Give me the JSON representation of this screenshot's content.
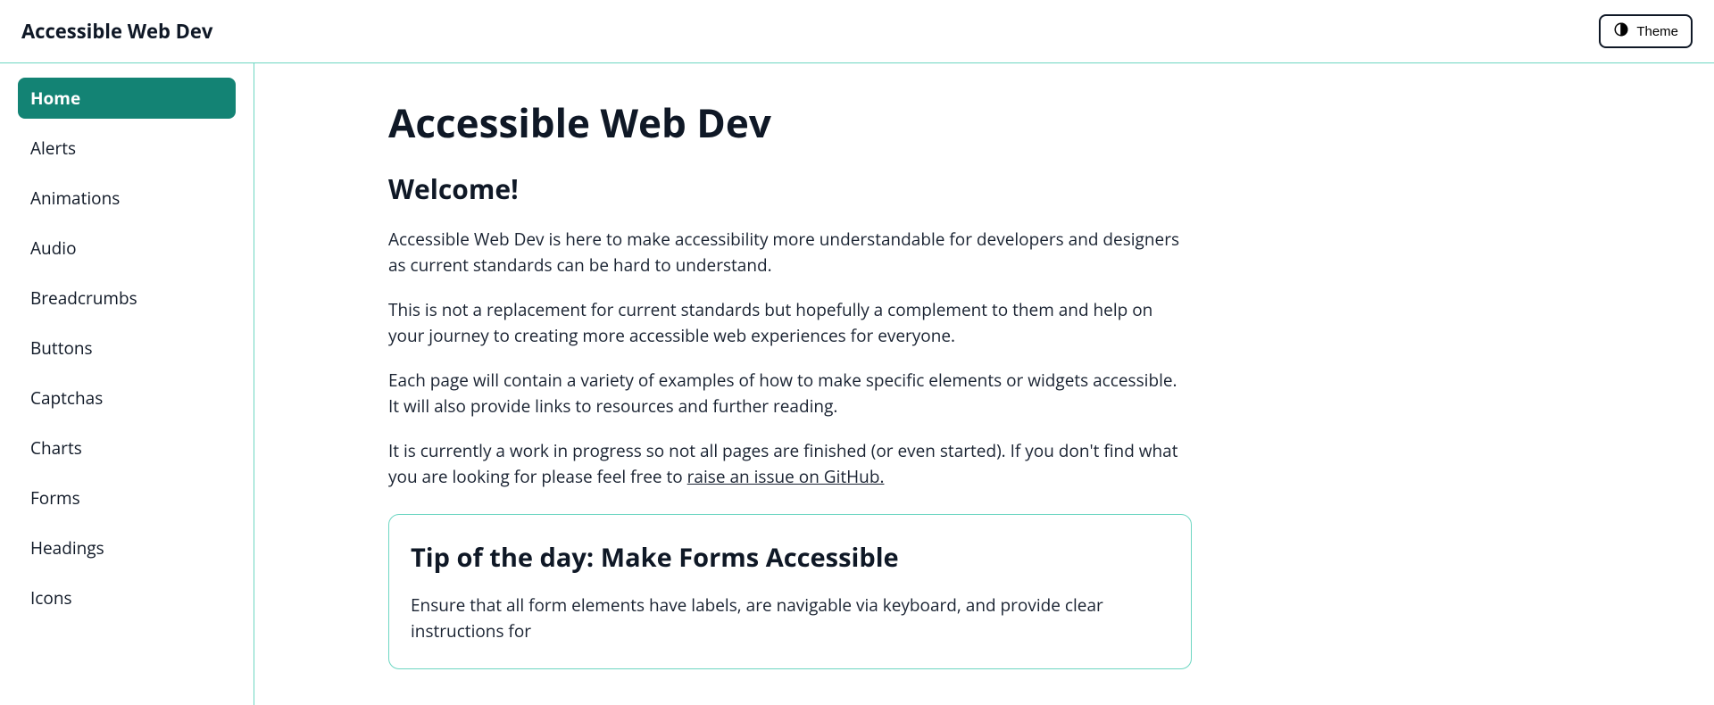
{
  "header": {
    "logo": "Accessible Web Dev",
    "theme_label": "Theme"
  },
  "sidebar": {
    "items": [
      {
        "label": "Home",
        "active": true
      },
      {
        "label": "Alerts",
        "active": false
      },
      {
        "label": "Animations",
        "active": false
      },
      {
        "label": "Audio",
        "active": false
      },
      {
        "label": "Breadcrumbs",
        "active": false
      },
      {
        "label": "Buttons",
        "active": false
      },
      {
        "label": "Captchas",
        "active": false
      },
      {
        "label": "Charts",
        "active": false
      },
      {
        "label": "Forms",
        "active": false
      },
      {
        "label": "Headings",
        "active": false
      },
      {
        "label": "Icons",
        "active": false
      }
    ]
  },
  "main": {
    "title": "Accessible Web Dev",
    "welcome": "Welcome!",
    "p1": "Accessible Web Dev is here to make accessibility more understandable for developers and designers as current standards can be hard to understand.",
    "p2": "This is not a replacement for current standards but hopefully a complement to them and help on your journey to creating more accessible web experiences for everyone.",
    "p3": "Each page will contain a variety of examples of how to make specific elements or widgets accessible. It will also provide links to resources and further reading.",
    "p4_prefix": "It is currently a work in progress so not all pages are finished (or even started). If you don't find what you are looking for please feel free to ",
    "p4_link": "raise an issue on GitHub.",
    "tip": {
      "title": "Tip of the day: Make Forms Accessible",
      "text": "Ensure that all form elements have labels, are navigable via keyboard, and provide clear instructions for"
    }
  }
}
